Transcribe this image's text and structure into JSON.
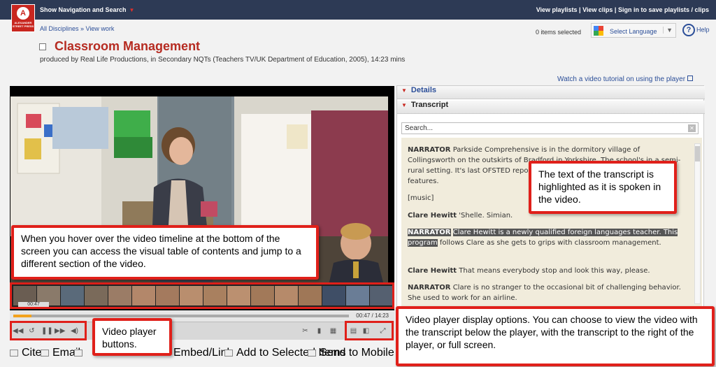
{
  "topbar": {
    "nav_toggle": "Show Navigation and Search",
    "right_links": "View playlists | View clips | Sign in to save playlists / clips"
  },
  "logo": {
    "text": "ALEXANDER STREET PRESS"
  },
  "breadcrumb": "All Disciplines » View work",
  "items_selected": "0 items selected",
  "language": {
    "label": "Select Language"
  },
  "help": "Help",
  "page_title": "Classroom Management",
  "subtitle": "produced by Real Life Productions, in Secondary NQTs (Teachers TV/UK Department of Education, 2005), 14:23 mins",
  "tutorial_link": "Watch a video tutorial on using the player",
  "player": {
    "hover_time": "00:47",
    "time_display": "00:47 / 14:23",
    "progress": 0.055
  },
  "actions": {
    "cite": "Cite",
    "email": "Email",
    "embed": "Embed/Link",
    "add_selected": "Add to Selected Items",
    "send_mobile": "Send to Mobile"
  },
  "panel": {
    "details": "Details",
    "transcript": "Transcript",
    "search_placeholder": "Search...",
    "lines": [
      {
        "speaker": "NARRATOR",
        "text": "Parkside Comprehensive is in the dormitory village of Collingsworth on the outskirts of Bradford in Yorkshire. The school's in a semi-rural setting. It's last OFSTED report identified a number of the outstanding features."
      },
      {
        "speaker": "",
        "text": "[music]"
      },
      {
        "speaker": "Clare Hewitt",
        "text": "'Shelle. Simian."
      },
      {
        "speaker": "NARRATOR",
        "hl": "Clare Hewitt is a newly qualified foreign languages teacher. This program",
        "text": "follows Clare as she gets to grips with classroom management."
      },
      {
        "speaker": "Clare Hewitt",
        "text": "That means everybody stop and look this way, please."
      },
      {
        "speaker": "NARRATOR",
        "text": "Clare is no stranger to the occasional bit of challenging behavior. She used to work for an airline."
      }
    ]
  },
  "callouts": {
    "transcript_highlight": "The text of the transcript is highlighted as it is spoken in the video.",
    "timeline": "When you hover over the video timeline at the bottom of the screen you can access the visual table of contents and jump to a different section of the video.",
    "buttons": "Video player buttons.",
    "display_options": "Video player display options. You can choose to view the video with the transcript below the player, with the transcript to the right of the player, or full screen."
  },
  "colors": {
    "brand_red": "#c8261f",
    "link_blue": "#2b4e98",
    "topbar": "#2d3a55",
    "callout_border": "#e0201a"
  }
}
